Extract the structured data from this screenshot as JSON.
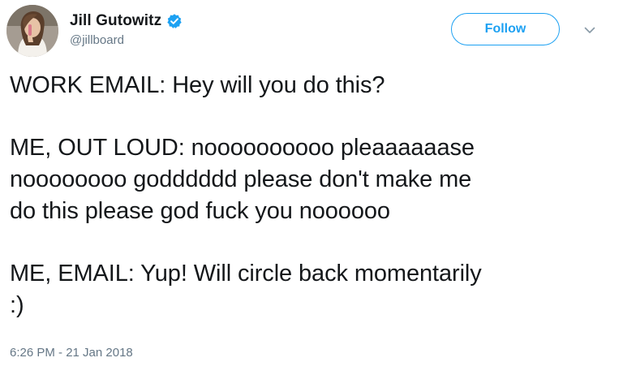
{
  "author": {
    "display_name": "Jill Gutowitz",
    "handle": "@jillboard",
    "verified": true,
    "avatar_icon": "profile-photo"
  },
  "actions": {
    "follow_label": "Follow",
    "menu_icon": "chevron-down-icon"
  },
  "tweet": {
    "paragraphs": [
      "WORK EMAIL: Hey will you do this?",
      "ME, OUT LOUD: noooooooooo pleaaaaaase\nnoooooooo godddddd please don't make me\ndo this please god fuck you noooooo",
      "ME, EMAIL: Yup! Will circle back momentarily\n:)"
    ],
    "timestamp": "6:26 PM - 21 Jan 2018"
  },
  "colors": {
    "accent": "#1da1f2",
    "text": "#14171a",
    "secondary": "#657786"
  }
}
